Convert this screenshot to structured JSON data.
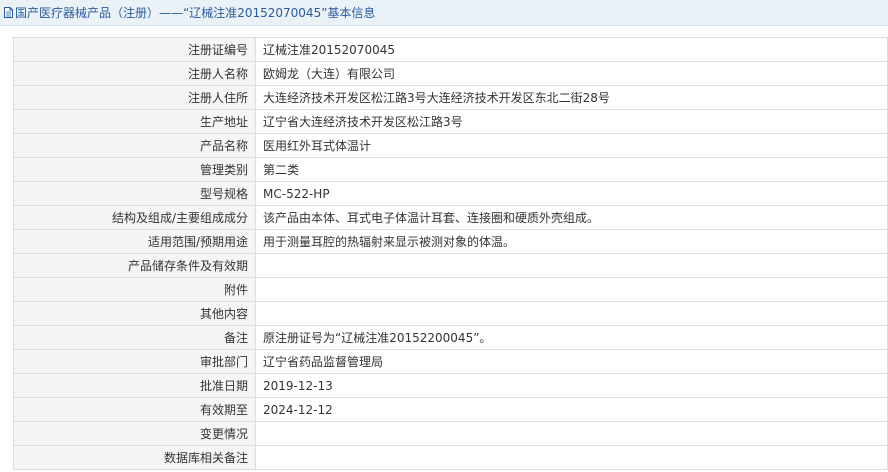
{
  "header": {
    "icon": "document-icon",
    "title": "国产医疗器械产品（注册）——“辽械注准20152070045”基本信息"
  },
  "colors": {
    "header_bg": "#eaf1f7",
    "header_text": "#2a5d9f",
    "label_bg": "#f5f5f5",
    "border": "#dddddd"
  },
  "rows": [
    {
      "label": "注册证编号",
      "value": "辽械注准20152070045"
    },
    {
      "label": "注册人名称",
      "value": "欧姆龙（大连）有限公司"
    },
    {
      "label": "注册人住所",
      "value": "大连经济技术开发区松江路3号大连经济技术开发区东北二街28号"
    },
    {
      "label": "生产地址",
      "value": "辽宁省大连经济技术开发区松江路3号"
    },
    {
      "label": "产品名称",
      "value": "医用红外耳式体温计"
    },
    {
      "label": "管理类别",
      "value": "第二类"
    },
    {
      "label": "型号规格",
      "value": "MC-522-HP"
    },
    {
      "label": "结构及组成/主要组成成分",
      "value": "该产品由本体、耳式电子体温计耳套、连接圈和硬质外壳组成。"
    },
    {
      "label": "适用范围/预期用途",
      "value": "用于测量耳腔的热辐射来显示被测对象的体温。"
    },
    {
      "label": "产品储存条件及有效期",
      "value": ""
    },
    {
      "label": "附件",
      "value": ""
    },
    {
      "label": "其他内容",
      "value": ""
    },
    {
      "label": "备注",
      "value": "原注册证号为“辽械注准20152200045”。"
    },
    {
      "label": "审批部门",
      "value": "辽宁省药品监督管理局"
    },
    {
      "label": "批准日期",
      "value": "2019-12-13"
    },
    {
      "label": "有效期至",
      "value": "2024-12-12"
    },
    {
      "label": "变更情况",
      "value": ""
    },
    {
      "label": "数据库相关备注",
      "value": ""
    }
  ]
}
